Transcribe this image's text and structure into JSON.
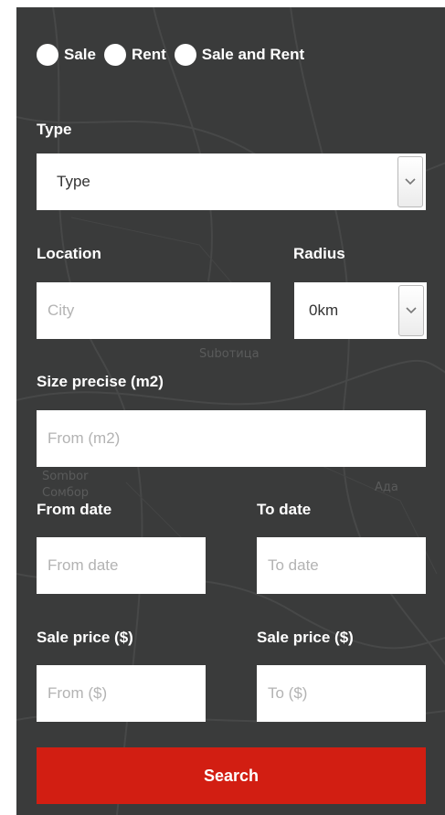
{
  "listing_type": {
    "options": [
      {
        "label": "Sale"
      },
      {
        "label": "Rent"
      },
      {
        "label": "Sale and Rent"
      }
    ]
  },
  "type": {
    "label": "Type",
    "selected": "Type"
  },
  "location": {
    "label": "Location",
    "placeholder": "City"
  },
  "radius": {
    "label": "Radius",
    "selected": "0km"
  },
  "size": {
    "label": "Size precise (m2)",
    "placeholder": "From (m2)"
  },
  "from_date": {
    "label": "From date",
    "placeholder": "From date"
  },
  "to_date": {
    "label": "To date",
    "placeholder": "To date"
  },
  "price_from": {
    "label": "Sale price ($)",
    "placeholder": "From ($)"
  },
  "price_to": {
    "label": "Sale price ($)",
    "placeholder": "To ($)"
  },
  "search_button": {
    "label": "Search"
  },
  "map_labels": [
    "Suboтица",
    "Sombor",
    "Сомбор",
    "Ада"
  ],
  "colors": {
    "panel": "#3a3b3b",
    "button": "#d21e12",
    "text": "#ffffff"
  }
}
